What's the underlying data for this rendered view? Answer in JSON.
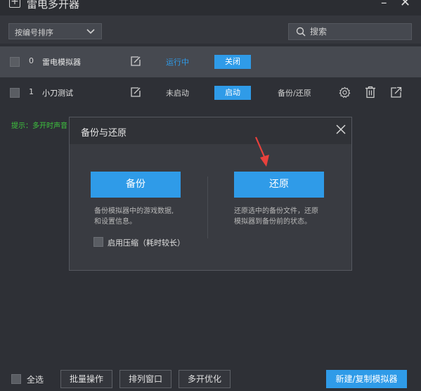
{
  "window": {
    "title": "雷电多开器",
    "minimize": "–",
    "close": "✕"
  },
  "toolbar": {
    "sort_label": "按编号排序",
    "search_placeholder": "搜索",
    "search_icon": "search-icon",
    "chevron_icon": "chevron-down-icon"
  },
  "emulators": [
    {
      "index": "0",
      "name": "雷电模拟器",
      "status": "运行中",
      "status_color": "#2f9be8",
      "action": "关闭"
    },
    {
      "index": "1",
      "name": "小刀测试",
      "status": "未启动",
      "status_color": "#cfcfcf",
      "action": "启动",
      "backup_restore": "备份/还原"
    }
  ],
  "hint": "提示：多开时声音",
  "dialog": {
    "title": "备份与还原",
    "backup_button": "备份",
    "restore_button": "还原",
    "backup_desc_line1": "备份模拟器中的游戏数据,",
    "backup_desc_line2": "和设置信息。",
    "restore_desc_line1": "还原选中的备份文件，还原",
    "restore_desc_line2": "模拟器到备份前的状态。",
    "compress_label": "启用压缩（耗时较长）"
  },
  "bottom": {
    "select_all": "全选",
    "batch": "批量操作",
    "arrange": "排列窗口",
    "optimize": "多开优化",
    "new_copy": "新建/复制模拟器"
  },
  "colors": {
    "accent": "#2f9be8",
    "hint_green": "#3ec43e",
    "arrow_red": "#e8413c"
  }
}
